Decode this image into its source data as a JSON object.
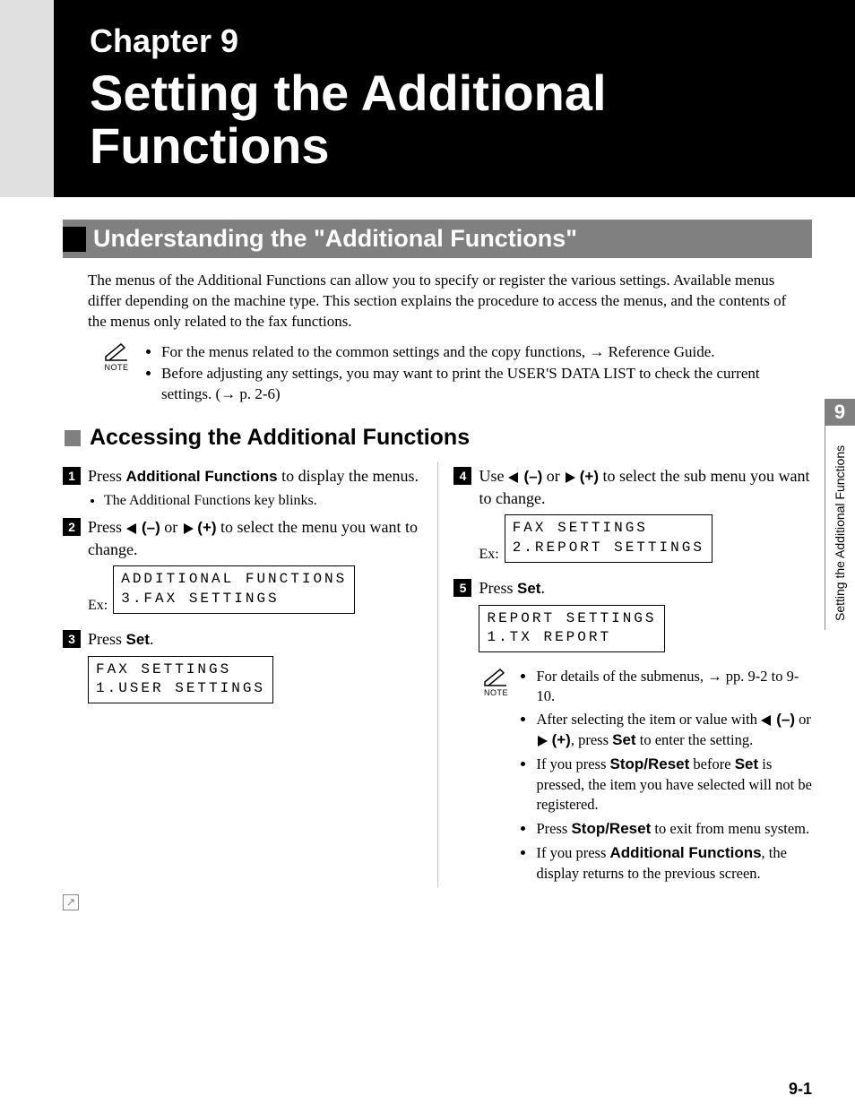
{
  "chapter_label": "Chapter 9",
  "chapter_title": "Setting the Additional Functions",
  "section_title": "Understanding the \"Additional Functions\"",
  "intro": "The menus of the Additional Functions can allow you to specify or register the various settings. Available menus differ depending on the machine type. This section explains the procedure to access the menus, and the contents of the menus only related to the fax functions.",
  "note_label": "NOTE",
  "intro_notes": [
    "For the menus related to the common settings and the copy functions, → Reference Guide.",
    "Before adjusting any settings, you may want to print the USER'S DATA LIST to check the current settings. (→ p. 2-6)"
  ],
  "subsection_title": "Accessing the Additional Functions",
  "ex_label": "Ex:",
  "steps": {
    "s1": {
      "text_a": "Press ",
      "bold": "Additional Functions",
      "text_b": " to display the menus.",
      "sub": "The Additional Functions key blinks."
    },
    "s2": {
      "text_a": "Press ",
      "minus": "(–)",
      "or": " or ",
      "plus": "(+)",
      "text_b": " to select the menu you want to change.",
      "lcd1": "ADDITIONAL FUNCTIONS",
      "lcd2": "3.FAX SETTINGS"
    },
    "s3": {
      "text_a": "Press ",
      "bold": "Set",
      "text_b": ".",
      "lcd1": "FAX SETTINGS",
      "lcd2": "1.USER SETTINGS"
    },
    "s4": {
      "text_a": "Use ",
      "minus": "(–)",
      "or": " or ",
      "plus": "(+)",
      "text_b": " to select the sub menu you want to change.",
      "lcd1": "FAX SETTINGS",
      "lcd2": "2.REPORT SETTINGS"
    },
    "s5": {
      "text_a": "Press ",
      "bold": "Set",
      "text_b": ".",
      "lcd1": "REPORT SETTINGS",
      "lcd2": "1.TX REPORT"
    }
  },
  "step5_notes": {
    "n1": "For details of the submenus, → pp. 9-2 to 9-10.",
    "n2a": "After selecting the item or value with ",
    "n2_minus": "(–)",
    "n2_or": " or ",
    "n2_plus": "(+)",
    "n2b": ", press ",
    "n2_set": "Set",
    "n2c": " to enter the setting.",
    "n3a": "If you press ",
    "n3_sr": "Stop/Reset",
    "n3b": " before ",
    "n3_set": "Set",
    "n3c": " is pressed, the item you have selected will not be registered.",
    "n4a": "Press ",
    "n4_sr": "Stop/Reset",
    "n4b": " to exit from menu system.",
    "n5a": "If you press ",
    "n5_af": "Additional Functions",
    "n5b": ", the display returns to the previous screen."
  },
  "tab_number": "9",
  "tab_text": "Setting the Additional Functions",
  "page_number": "9-1",
  "corner_arrow": "↗"
}
